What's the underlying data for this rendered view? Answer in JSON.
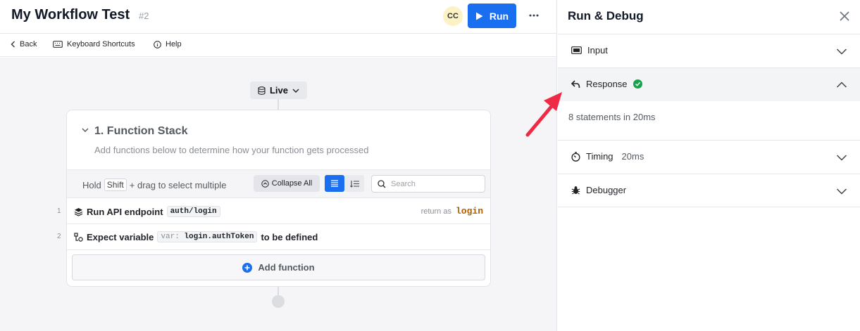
{
  "header": {
    "title": "My Workflow Test",
    "revision": "#2",
    "avatar_initials": "CC",
    "run_label": "Run",
    "more_label": "···"
  },
  "subbar": {
    "back_label": "Back",
    "shortcuts_label": "Keyboard Shortcuts",
    "help_label": "Help"
  },
  "canvas": {
    "env_label": "Live",
    "stack": {
      "title": "1. Function Stack",
      "subtitle": "Add functions below to determine how your function gets processed",
      "hint_prefix": "Hold",
      "hint_key": "Shift",
      "hint_suffix": "+ drag to select multiple",
      "collapse_all_label": "Collapse All",
      "search_placeholder": "Search",
      "rows": [
        {
          "num": "1",
          "label": "Run API endpoint",
          "code": "auth/login",
          "return_label": "return as",
          "return_var": "login"
        },
        {
          "num": "2",
          "label": "Expect variable",
          "code_prefix": "var:",
          "code": "login.authToken",
          "suffix": "to be defined"
        }
      ],
      "add_function_label": "Add function"
    }
  },
  "panel": {
    "title": "Run & Debug",
    "sections": [
      {
        "label": "Input",
        "icon": "input-box-icon",
        "expanded": false
      },
      {
        "label": "Response",
        "icon": "reply-icon",
        "expanded": true,
        "status": "success",
        "body": "8 statements in 20ms"
      },
      {
        "label": "Timing",
        "icon": "stopwatch-icon",
        "expanded": false,
        "extra": "20ms"
      },
      {
        "label": "Debugger",
        "icon": "bug-icon",
        "expanded": false
      }
    ]
  },
  "colors": {
    "accent": "#1a6ef0",
    "success": "#16a34a",
    "return_var": "#b35e00",
    "annotation_arrow": "#ee2a45"
  }
}
